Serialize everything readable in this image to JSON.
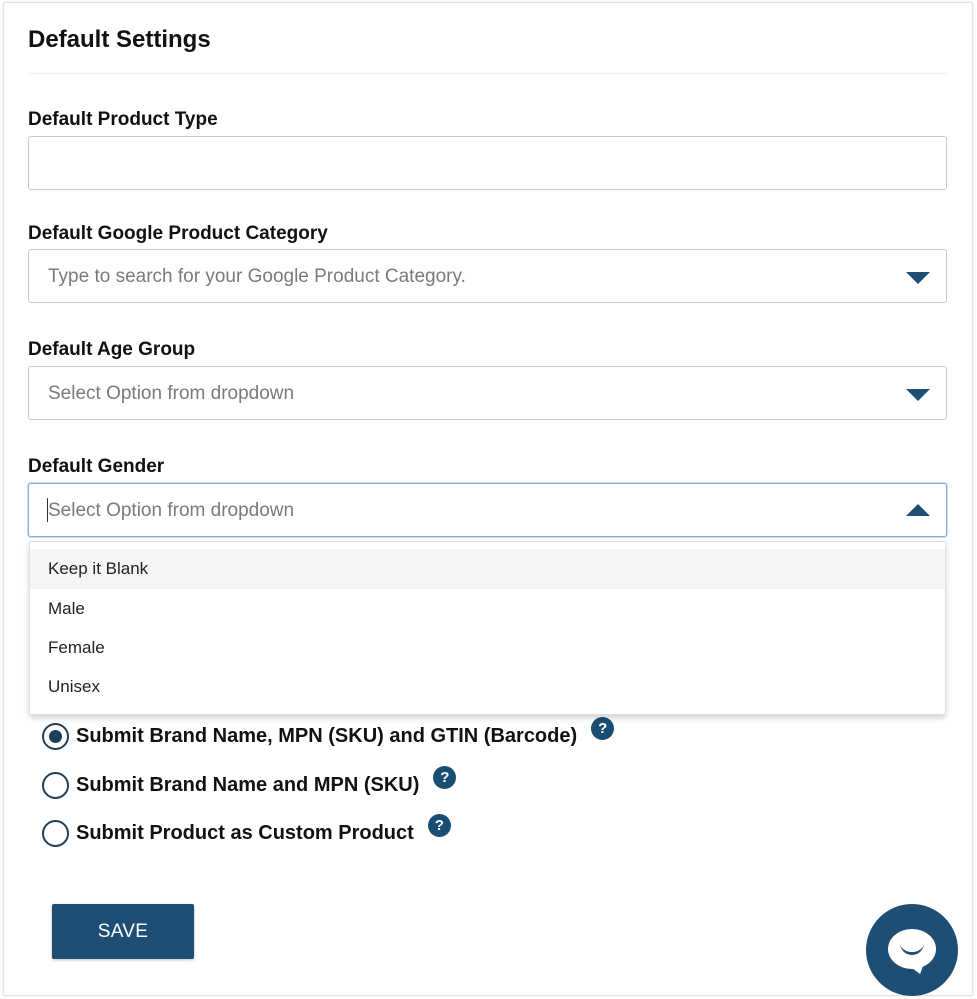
{
  "page": {
    "title": "Default Settings"
  },
  "fields": {
    "product_type": {
      "label": "Default Product Type",
      "value": ""
    },
    "google_category": {
      "label": "Default Google Product Category",
      "placeholder": "Type to search for your Google Product Category."
    },
    "age_group": {
      "label": "Default Age Group",
      "placeholder": "Select Option from dropdown"
    },
    "gender": {
      "label": "Default Gender",
      "placeholder": "Select Option from dropdown",
      "options": [
        "Keep it Blank",
        "Male",
        "Female",
        "Unisex"
      ],
      "highlighted_option": "Keep it Blank"
    }
  },
  "submission_options": [
    {
      "label": "Submit Brand Name, MPN (SKU) and GTIN (Barcode)",
      "checked": true
    },
    {
      "label": "Submit Brand Name and MPN (SKU)",
      "checked": false
    },
    {
      "label": "Submit Product as Custom Product",
      "checked": false
    }
  ],
  "help_icon_glyph": "?",
  "actions": {
    "save_label": "SAVE"
  },
  "colors": {
    "accent": "#1f4e74",
    "focus_border": "#7fb0e0"
  },
  "icons": {
    "dropdown_closed": "chevron-down-icon",
    "dropdown_open": "chevron-up-icon",
    "help": "question-circle-icon",
    "chat": "chat-bubble-icon"
  }
}
